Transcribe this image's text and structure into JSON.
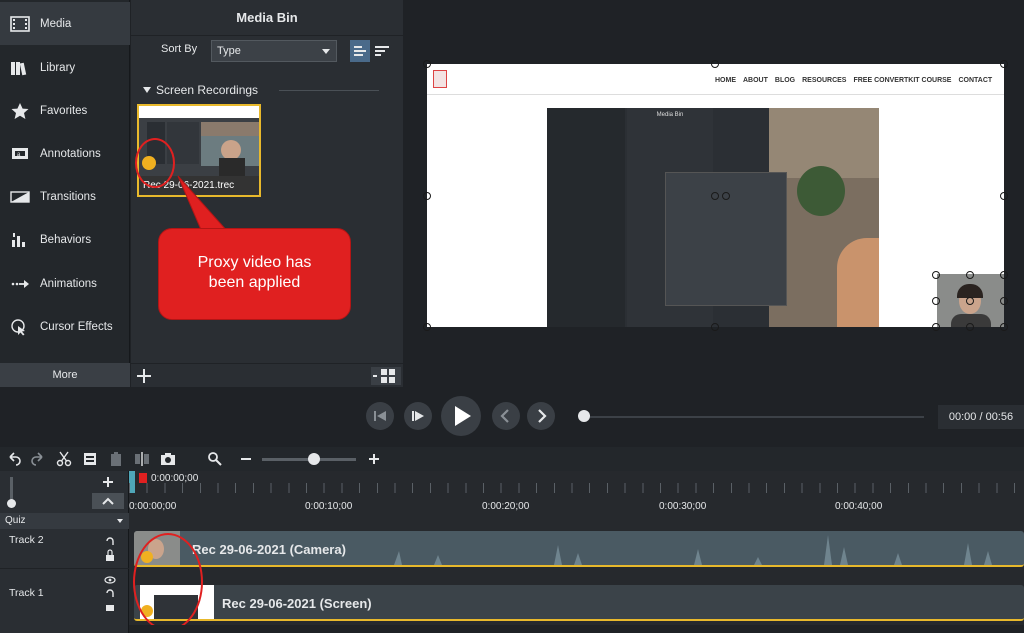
{
  "sidebar": {
    "items": [
      {
        "label": "Media",
        "icon": "film-icon"
      },
      {
        "label": "Library",
        "icon": "library-icon"
      },
      {
        "label": "Favorites",
        "icon": "star-icon"
      },
      {
        "label": "Annotations",
        "icon": "annotation-icon"
      },
      {
        "label": "Transitions",
        "icon": "transition-icon"
      },
      {
        "label": "Behaviors",
        "icon": "behavior-icon"
      },
      {
        "label": "Animations",
        "icon": "animation-arrow-icon"
      },
      {
        "label": "Cursor Effects",
        "icon": "cursor-effect-icon"
      }
    ],
    "more_label": "More"
  },
  "media_bin": {
    "title": "Media Bin",
    "sort_label": "Sort By",
    "sort_value": "Type",
    "section_title": "Screen Recordings",
    "item_name": "Rec 29-06-2021.trec"
  },
  "callout": {
    "line1": "Proxy video has",
    "line2": "been applied"
  },
  "canvas": {
    "nav": [
      "HOME",
      "ABOUT",
      "BLOG",
      "RESOURCES",
      "FREE CONVERTKIT COURSE",
      "CONTACT"
    ],
    "inner_title": "Media Bin"
  },
  "playback": {
    "timecode": "00:00 / 00:56"
  },
  "timeline": {
    "playhead_time": "0:00:00;00",
    "ticks": [
      "0:00:00;00",
      "0:00:10;00",
      "0:00:20;00",
      "0:00:30;00",
      "0:00:40;00"
    ],
    "quiz_label": "Quiz",
    "tracks": [
      {
        "name": "Track 2",
        "clip": "Rec 29-06-2021 (Camera)"
      },
      {
        "name": "Track 1",
        "clip": "Rec 29-06-2021 (Screen)"
      }
    ]
  },
  "colors": {
    "accent": "#e8b92c",
    "callout": "#e02020",
    "camera_clip": "#4a5a63",
    "screen_clip": "#3b4349"
  }
}
